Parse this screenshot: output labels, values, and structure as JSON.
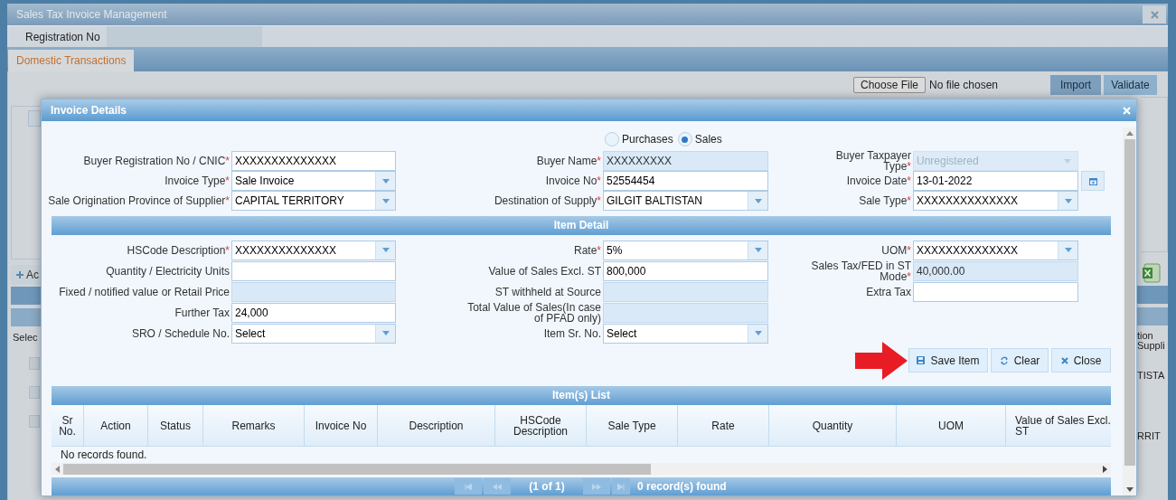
{
  "window": {
    "title": "Sales Tax Invoice Management"
  },
  "registration": {
    "label": "Registration No"
  },
  "tabs": [
    {
      "label": "Domestic Transactions",
      "selected": true
    }
  ],
  "file_picker": {
    "button": "Choose File",
    "status": "No file chosen"
  },
  "toolbar_buttons": [
    "Import",
    "Validate"
  ],
  "background": {
    "add_label": "Ac",
    "select_label": "Selec",
    "header_fragments": [
      "tion",
      "Suppli"
    ],
    "cell_fragments": [
      "TISTA",
      "RRIT"
    ]
  },
  "dialog": {
    "title": "Invoice Details",
    "mode_options": [
      {
        "label": "Purchases",
        "selected": false
      },
      {
        "label": "Sales",
        "selected": true
      }
    ],
    "header_rows": [
      {
        "fields": [
          {
            "label": "Buyer Registration No / CNIC",
            "required_mark": "*",
            "kind": "text",
            "value": "XXXXXXXXXXXXXX"
          },
          {
            "label": "Buyer Name",
            "required_mark": "*",
            "kind": "readonly",
            "value": "XXXXXXXXX"
          },
          {
            "label": "Buyer Taxpayer Type",
            "required_mark": "*",
            "kind": "disabled_select",
            "value": "Unregistered"
          }
        ]
      },
      {
        "fields": [
          {
            "label": "Invoice Type",
            "required_mark": "*",
            "kind": "select",
            "value": "Sale Invoice"
          },
          {
            "label": "Invoice No",
            "required_mark": "*",
            "kind": "text",
            "value": "52554454"
          },
          {
            "label": "Invoice Date",
            "required_mark": "*",
            "kind": "date",
            "value": "13-01-2022"
          }
        ]
      },
      {
        "fields": [
          {
            "label": "Sale Origination Province of Supplier",
            "required_mark": "*",
            "kind": "select",
            "value": "CAPITAL TERRITORY"
          },
          {
            "label": "Destination of Supply",
            "required_mark": "*",
            "kind": "select",
            "value": "GILGIT BALTISTAN"
          },
          {
            "label": "Sale Type",
            "required_mark": "*",
            "kind": "select",
            "value": "XXXXXXXXXXXXXX"
          }
        ]
      }
    ],
    "item_detail_title": "Item Detail",
    "item_rows": [
      {
        "fields": [
          {
            "label": "HSCode Description",
            "required_mark": "*",
            "kind": "select",
            "value": "XXXXXXXXXXXXXX"
          },
          {
            "label": "Rate",
            "required_mark": "*",
            "kind": "select",
            "value": "5%"
          },
          {
            "label": "UOM",
            "required_mark": "*",
            "kind": "select",
            "value": "XXXXXXXXXXXXXX"
          }
        ]
      },
      {
        "fields": [
          {
            "label": "Quantity / Electricity Units",
            "kind": "text"
          },
          {
            "label": "Value of Sales Excl. ST",
            "kind": "text",
            "value": "800,000"
          },
          {
            "label": "Sales Tax/FED in ST Mode",
            "required_mark": "*",
            "kind": "readonly",
            "value": "40,000.00"
          }
        ]
      },
      {
        "fields": [
          {
            "label": "Fixed / notified value or Retail Price",
            "kind": "readonly"
          },
          {
            "label": "ST withheld at Source",
            "kind": "readonly"
          },
          {
            "label": "Extra Tax",
            "kind": "text"
          }
        ]
      },
      {
        "fields": [
          {
            "label": "Further Tax",
            "kind": "text",
            "value": "24,000"
          },
          {
            "label": "Total Value of Sales(In case of PFAD only)",
            "kind": "readonly"
          }
        ]
      },
      {
        "fields": [
          {
            "label": "SRO / Schedule No.",
            "kind": "select",
            "value": "Select"
          },
          {
            "label": "Item Sr. No.",
            "kind": "select",
            "value": "Select"
          }
        ]
      }
    ],
    "buttons": [
      "Save Item",
      "Clear",
      "Close"
    ],
    "items_list": {
      "title": "Item(s) List",
      "columns": [
        "Sr No.",
        "Action",
        "Status",
        "Remarks",
        "Invoice No",
        "Description",
        "HSCode Description",
        "Sale Type",
        "Rate",
        "Quantity",
        "UOM",
        "Value of Sales Excl. ST"
      ],
      "empty_text": "No records found.",
      "pager": {
        "page": "(1 of 1)",
        "count": "0 record(s) found"
      }
    }
  }
}
